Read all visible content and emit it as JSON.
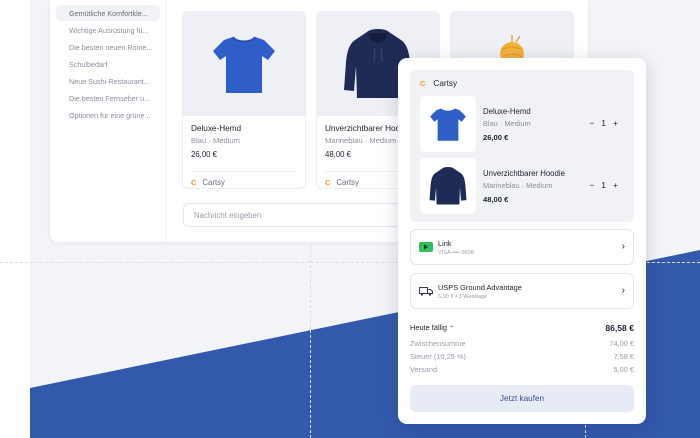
{
  "colors": {
    "accent_blue": "#3359ad",
    "brand_orange": "#f0952c",
    "link_green": "#2fbe5f",
    "shirt_blue": "#2f5ec9",
    "hoodie_navy": "#1f2a55"
  },
  "sidebar": {
    "items": [
      {
        "label": "Gemütliche Komfortkle..."
      },
      {
        "label": "Wichtige Ausrüstung fü..."
      },
      {
        "label": "Die besten neuen Rome..."
      },
      {
        "label": "Schulbedarf"
      },
      {
        "label": "Neue Sushi-Restaurant..."
      },
      {
        "label": "Die besten Fernseher u..."
      },
      {
        "label": "Optionen für eine grüne..."
      }
    ]
  },
  "products": [
    {
      "title": "Deluxe-Hemd",
      "variant": "Blau · Medium",
      "price": "26,00 €",
      "store": "Cartsy",
      "icon": "tshirt-icon"
    },
    {
      "title": "Unverzichtbarer Hoodie",
      "variant": "Marineblau · Medium",
      "price": "48,00 €",
      "store": "Cartsy",
      "icon": "hoodie-icon"
    },
    {
      "icon": "yarn-ball-icon"
    }
  ],
  "chat": {
    "placeholder": "Nachricht eingeben"
  },
  "checkout": {
    "store": "Cartsy",
    "store_logo": "C",
    "items": [
      {
        "title": "Deluxe-Hemd",
        "variant": "Blau · Medium",
        "price": "26,00 €",
        "qty": "1",
        "minus": "−",
        "plus": "+"
      },
      {
        "title": "Unverzichtbarer Hoodie",
        "variant": "Marineblau · Medium",
        "price": "48,00 €",
        "qty": "1",
        "minus": "−",
        "plus": "+"
      }
    ],
    "payment": {
      "title": "Link",
      "detail": "VISA •••• 0608",
      "chevron": "›"
    },
    "shipping": {
      "title": "USPS Ground Advantage",
      "detail": "5,00 € • 3 Werktage",
      "chevron": "›"
    },
    "due": {
      "label": "Heute fällig",
      "caret": "⌃",
      "value": "86,58 €"
    },
    "subtotal": {
      "label": "Zwischensumme",
      "value": "74,00 €"
    },
    "tax": {
      "label": "Steuer (10,25 %)",
      "value": "7,58 €"
    },
    "shipping_cost": {
      "label": "Versand",
      "value": "5,00 €"
    },
    "buy_label": "Jetzt kaufen"
  }
}
